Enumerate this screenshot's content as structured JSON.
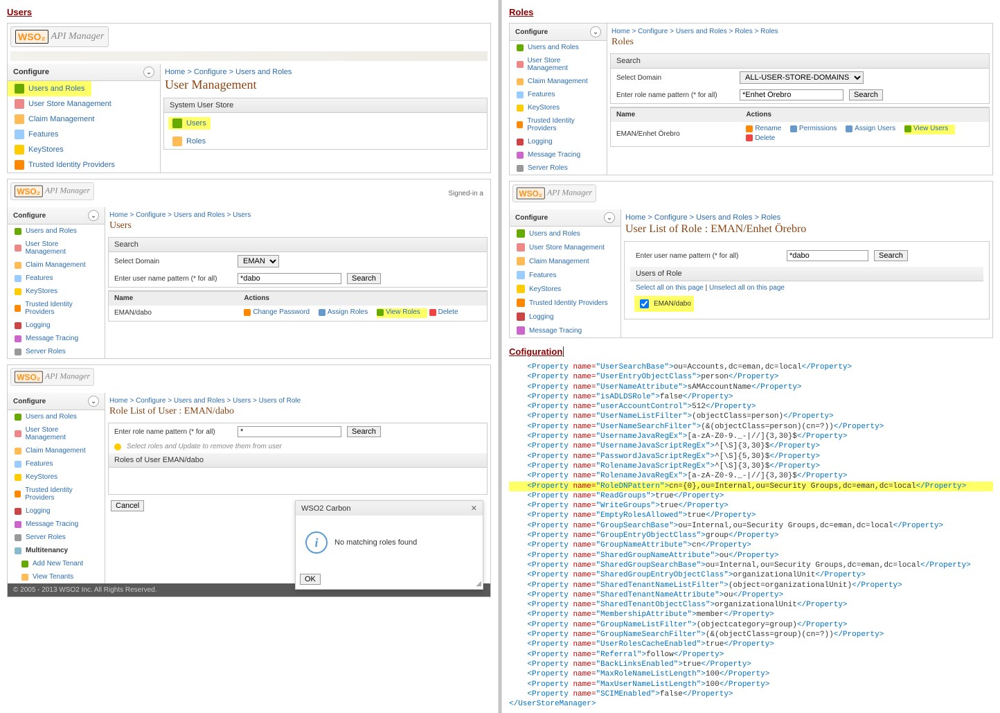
{
  "sections": {
    "users": "Users",
    "roles": "Roles",
    "config": "Cofiguration"
  },
  "brand": {
    "wso2": "WSO₂",
    "product": "API Manager"
  },
  "configure_label": "Configure",
  "nav": {
    "users_roles": "Users and Roles",
    "user_store": "User Store Management",
    "claim": "Claim Management",
    "features": "Features",
    "keystores": "KeyStores",
    "tip": "Trusted Identity Providers",
    "logging": "Logging",
    "msg_trace": "Message Tracing",
    "server_roles": "Server Roles",
    "multitenancy": "Multitenancy",
    "add_tenant": "Add New Tenant",
    "view_tenants": "View Tenants"
  },
  "signed_in": "Signed-in a",
  "p1": {
    "bc": "Home > Configure > Users and Roles",
    "title": "User Management",
    "store_hd": "System User Store",
    "users": "Users",
    "roles": "Roles"
  },
  "p2": {
    "bc": "Home > Configure > Users and Roles > Users",
    "title": "Users",
    "search": "Search",
    "sel_domain": "Select Domain",
    "domain_val": "EMAN",
    "pattern_lbl": "Enter user name pattern (* for all)",
    "pattern_val": "*dabo",
    "search_btn": "Search",
    "col_name": "Name",
    "col_actions": "Actions",
    "row_name": "EMAN/dabo",
    "a_chgpw": "Change Password",
    "a_assign": "Assign Roles",
    "a_view": "View Roles",
    "a_delete": "Delete"
  },
  "p3": {
    "bc": "Home > Configure > Users and Roles > Users > Users of Role",
    "title": "Role List of User : EMAN/dabo",
    "pattern_lbl": "Enter role name pattern (* for all)",
    "pattern_val": "*",
    "search_btn": "Search",
    "hint": "Select roles and Update to remove them from user",
    "roles_hd": "Roles of User EMAN/dabo",
    "cancel": "Cancel",
    "dlg_title": "WSO2 Carbon",
    "dlg_msg": "No matching roles found",
    "dlg_ok": "OK",
    "footer": "© 2005 - 2013 WSO2 Inc. All Rights Reserved."
  },
  "r1": {
    "bc": "Home > Configure > Users and Roles > Roles > Roles",
    "title": "Roles",
    "search": "Search",
    "sel_domain": "Select Domain",
    "domain_val": "ALL-USER-STORE-DOMAINS",
    "pattern_lbl": "Enter role name pattern (* for all)",
    "pattern_val": "*Enhet Örebro",
    "search_btn": "Search",
    "col_name": "Name",
    "col_actions": "Actions",
    "row_name": "EMAN/Enhet Örebro",
    "a_rename": "Rename",
    "a_perm": "Permissions",
    "a_assign": "Assign Users",
    "a_view": "View Users",
    "a_delete": "Delete"
  },
  "r2": {
    "bc": "Home > Configure > Users and Roles > Roles",
    "title": "User List of Role : EMAN/Enhet Örebro",
    "pattern_lbl": "Enter user name pattern (* for all)",
    "pattern_val": "*dabo",
    "search_btn": "Search",
    "roles_hd": "Users of Role",
    "sel_all": "Select all on this page",
    "unsel": "Unselect all on this page",
    "user": "EMAN/dabo"
  },
  "cfg_props": [
    {
      "n": "UserSearchBase",
      "v": "ou=Accounts,dc=eman,dc=local",
      "hl": false
    },
    {
      "n": "UserEntryObjectClass",
      "v": "person",
      "hl": false
    },
    {
      "n": "UserNameAttribute",
      "v": "sAMAccountName",
      "hl": false
    },
    {
      "n": "isADLDSRole",
      "v": "false",
      "hl": false
    },
    {
      "n": "userAccountControl",
      "v": "512",
      "hl": false
    },
    {
      "n": "UserNameListFilter",
      "v": "(objectClass=person)",
      "hl": false
    },
    {
      "n": "UserNameSearchFilter",
      "v": "(&amp;(objectClass=person)(cn=?))",
      "hl": false
    },
    {
      "n": "UsernameJavaRegEx",
      "v": "[a-zA-Z0-9._-|//]{3,30}$",
      "hl": false
    },
    {
      "n": "UsernameJavaScriptRegEx",
      "v": "^[\\S]{3,30}$",
      "hl": false
    },
    {
      "n": "PasswordJavaScriptRegEx",
      "v": "^[\\S]{5,30}$",
      "hl": false
    },
    {
      "n": "RolenameJavaScriptRegEx",
      "v": "^[\\S]{3,30}$",
      "hl": false
    },
    {
      "n": "RolenameJavaRegEx",
      "v": "[a-zA-Z0-9._-|//]{3,30}$",
      "hl": false
    },
    {
      "n": "RoleDNPattern",
      "v": "cn={0},ou=Internal,ou=Security Groups,dc=eman,dc=local",
      "hl": true
    },
    {
      "n": "ReadGroups",
      "v": "true",
      "hl": false
    },
    {
      "n": "WriteGroups",
      "v": "true",
      "hl": false
    },
    {
      "n": "EmptyRolesAllowed",
      "v": "true",
      "hl": false
    },
    {
      "n": "GroupSearchBase",
      "v": "ou=Internal,ou=Security Groups,dc=eman,dc=local",
      "hl": false
    },
    {
      "n": "GroupEntryObjectClass",
      "v": "group",
      "hl": false
    },
    {
      "n": "GroupNameAttribute",
      "v": "cn",
      "hl": false
    },
    {
      "n": "SharedGroupNameAttribute",
      "v": "ou",
      "hl": false
    },
    {
      "n": "SharedGroupSearchBase",
      "v": "ou=Internal,ou=Security Groups,dc=eman,dc=local",
      "hl": false
    },
    {
      "n": "SharedGroupEntryObjectClass",
      "v": "organizationalUnit",
      "hl": false
    },
    {
      "n": "SharedTenantNameListFilter",
      "v": "(object=organizationalUnit)",
      "hl": false
    },
    {
      "n": "SharedTenantNameAttribute",
      "v": "ou",
      "hl": false
    },
    {
      "n": "SharedTenantObjectClass",
      "v": "organizationalUnit",
      "hl": false
    },
    {
      "n": "MembershipAttribute",
      "v": "member",
      "hl": false
    },
    {
      "n": "GroupNameListFilter",
      "v": "(objectcategory=group)",
      "hl": false
    },
    {
      "n": "GroupNameSearchFilter",
      "v": "(&amp;(objectClass=group)(cn=?))",
      "hl": false
    },
    {
      "n": "UserRolesCacheEnabled",
      "v": "true",
      "hl": false
    },
    {
      "n": "Referral",
      "v": "follow",
      "hl": false
    },
    {
      "n": "BackLinksEnabled",
      "v": "true",
      "hl": false
    },
    {
      "n": "MaxRoleNameListLength",
      "v": "100",
      "hl": false
    },
    {
      "n": "MaxUserNameListLength",
      "v": "100",
      "hl": false
    },
    {
      "n": "SCIMEnabled",
      "v": "false",
      "hl": false
    }
  ],
  "cfg_close": "</UserStoreManager>"
}
